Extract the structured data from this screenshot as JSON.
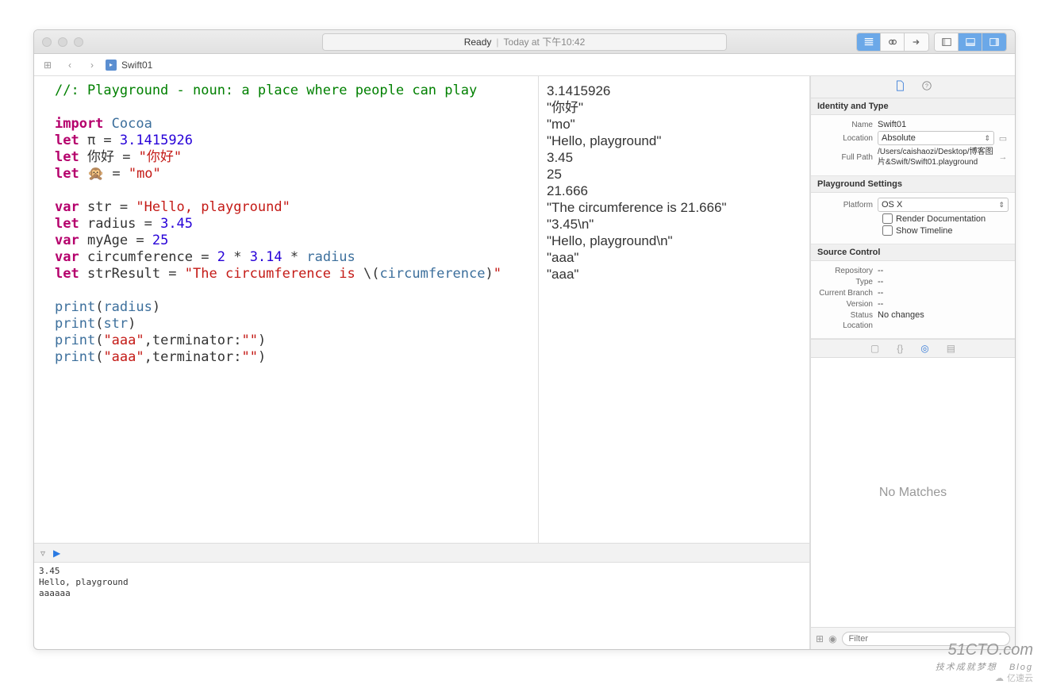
{
  "titlebar": {
    "status": "Ready",
    "time": "Today at 下午10:42"
  },
  "navbar": {
    "filename": "Swift01"
  },
  "code": {
    "lines": [
      {
        "t": "cmt",
        "txt": "//: Playground - noun: a place where people can play"
      },
      {
        "t": "blank"
      },
      {
        "t": "import",
        "kw": "import",
        "mod": "Cocoa"
      },
      {
        "t": "let_num",
        "kw": "let",
        "name": "π",
        "val": "3.1415926"
      },
      {
        "t": "let_str",
        "kw": "let",
        "name": "你好",
        "val": "\"你好\""
      },
      {
        "t": "let_str",
        "kw": "let",
        "name": "🙊",
        "val": "\"mo\""
      },
      {
        "t": "blank"
      },
      {
        "t": "var_str",
        "kw": "var",
        "name": "str",
        "val": "\"Hello, playground\""
      },
      {
        "t": "let_num",
        "kw": "let",
        "name": "radius",
        "val": "3.45"
      },
      {
        "t": "var_num",
        "kw": "var",
        "name": "myAge",
        "val": "25"
      },
      {
        "t": "circ",
        "kw": "var",
        "name": "circumference"
      },
      {
        "t": "strres",
        "kw": "let",
        "name": "strResult"
      },
      {
        "t": "blank"
      },
      {
        "t": "print_id",
        "fn": "print",
        "arg": "radius"
      },
      {
        "t": "print_id",
        "fn": "print",
        "arg": "str"
      },
      {
        "t": "print_term",
        "fn": "print",
        "s": "\"aaa\"",
        "term": "\"\""
      },
      {
        "t": "print_term",
        "fn": "print",
        "s": "\"aaa\"",
        "term": "\"\""
      }
    ]
  },
  "results": [
    "",
    "",
    "",
    "3.1415926",
    "\"你好\"",
    "\"mo\"",
    "",
    "\"Hello, playground\"",
    "3.45",
    "25",
    "21.666",
    "\"The circumference is 21.666\"",
    "",
    "\"3.45\\n\"",
    "\"Hello, playground\\n\"",
    "\"aaa\"",
    "\"aaa\""
  ],
  "console": "3.45\nHello, playground\naaaaaa",
  "inspector": {
    "identity": {
      "header": "Identity and Type",
      "name_lbl": "Name",
      "name_val": "Swift01",
      "loc_lbl": "Location",
      "loc_val": "Absolute",
      "path_lbl": "Full Path",
      "path_val": "/Users/caishaozi/Desktop/博客图片&Swift/Swift01.playground"
    },
    "settings": {
      "header": "Playground Settings",
      "platform_lbl": "Platform",
      "platform_val": "OS X",
      "render_doc": "Render Documentation",
      "show_timeline": "Show Timeline"
    },
    "source": {
      "header": "Source Control",
      "repo_lbl": "Repository",
      "repo_val": "--",
      "type_lbl": "Type",
      "type_val": "--",
      "branch_lbl": "Current Branch",
      "branch_val": "--",
      "version_lbl": "Version",
      "version_val": "--",
      "status_lbl": "Status",
      "status_val": "No changes",
      "loc_lbl": "Location",
      "loc_val": ""
    },
    "no_matches": "No Matches",
    "filter_placeholder": "Filter"
  },
  "watermark": {
    "top": "51CTO.com",
    "sub": "技术成就梦想",
    "blog": "Blog",
    "cloud": "亿速云"
  }
}
